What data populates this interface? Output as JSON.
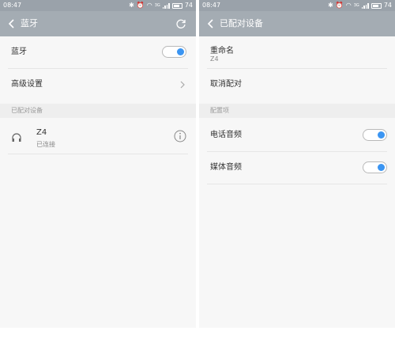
{
  "left": {
    "status": {
      "time": "08:47",
      "network": "3G",
      "battery": "74"
    },
    "title": "蓝牙",
    "bluetooth_row": {
      "label": "蓝牙",
      "enabled": true
    },
    "advanced_row": {
      "label": "高级设置"
    },
    "paired_section": {
      "label": "已配对设备"
    },
    "device": {
      "name": "Z4",
      "status": "已连接"
    }
  },
  "right": {
    "status": {
      "time": "08:47",
      "network": "3G",
      "battery": "74"
    },
    "title": "已配对设备",
    "rename": {
      "label": "重命名",
      "value": "Z4"
    },
    "unpair": {
      "label": "取消配对"
    },
    "config_section": {
      "label": "配置项"
    },
    "phone_audio": {
      "label": "电话音频",
      "enabled": true
    },
    "media_audio": {
      "label": "媒体音频",
      "enabled": true
    }
  },
  "colors": {
    "toggle_on": "#3b95f2",
    "header": "#a4acb3"
  },
  "icons": [
    "back-arrow-icon",
    "refresh-icon",
    "chevron-right-icon",
    "headphone-icon",
    "info-icon",
    "bluetooth-icon",
    "alarm-icon",
    "wifi-icon",
    "signal-icon",
    "battery-icon"
  ]
}
